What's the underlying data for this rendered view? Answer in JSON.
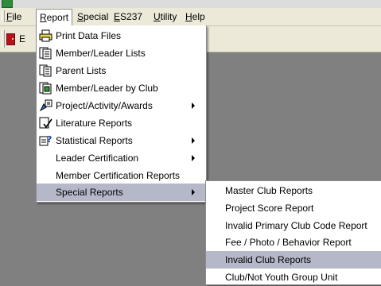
{
  "menubar": {
    "items": [
      {
        "label": "File",
        "underline": "F"
      },
      {
        "label": "Report",
        "underline": "R"
      },
      {
        "label": "Special",
        "underline": "S"
      },
      {
        "label": "ES237",
        "underline": "E"
      },
      {
        "label": "Utility",
        "underline": "U"
      },
      {
        "label": "Help",
        "underline": "H"
      }
    ]
  },
  "toolbar": {
    "exit_label": "E"
  },
  "report_menu": {
    "items": [
      {
        "label": "Print Data Files",
        "icon": "printer-icon"
      },
      {
        "label": "Member/Leader Lists",
        "icon": "list-document-icon"
      },
      {
        "label": "Parent Lists",
        "icon": "parent-list-icon"
      },
      {
        "label": "Member/Leader by Club",
        "icon": "club-list-icon"
      },
      {
        "label": "Project/Activity/Awards",
        "icon": "project-awards-icon",
        "submenu": true
      },
      {
        "label": "Literature Reports",
        "icon": "literature-check-icon"
      },
      {
        "label": "Statistical Reports",
        "icon": "statistics-icon",
        "submenu": true
      },
      {
        "label": "Leader Certification",
        "submenu": true
      },
      {
        "label": "Member Certification Reports"
      },
      {
        "label": "Special Reports",
        "submenu": true,
        "highlighted": true
      }
    ]
  },
  "special_reports_menu": {
    "items": [
      {
        "label": "Master Club Reports"
      },
      {
        "label": "Project Score Report"
      },
      {
        "label": "Invalid Primary Club Code Report"
      },
      {
        "label": "Fee / Photo / Behavior Report"
      },
      {
        "label": "Invalid Club Reports",
        "highlighted": true
      },
      {
        "label": "Club/Not Youth Group Unit"
      }
    ]
  },
  "colors": {
    "desktop": "#808080",
    "menu_background": "#ffffff",
    "highlight": "#b5b8c8",
    "chrome": "#ece9d8"
  }
}
